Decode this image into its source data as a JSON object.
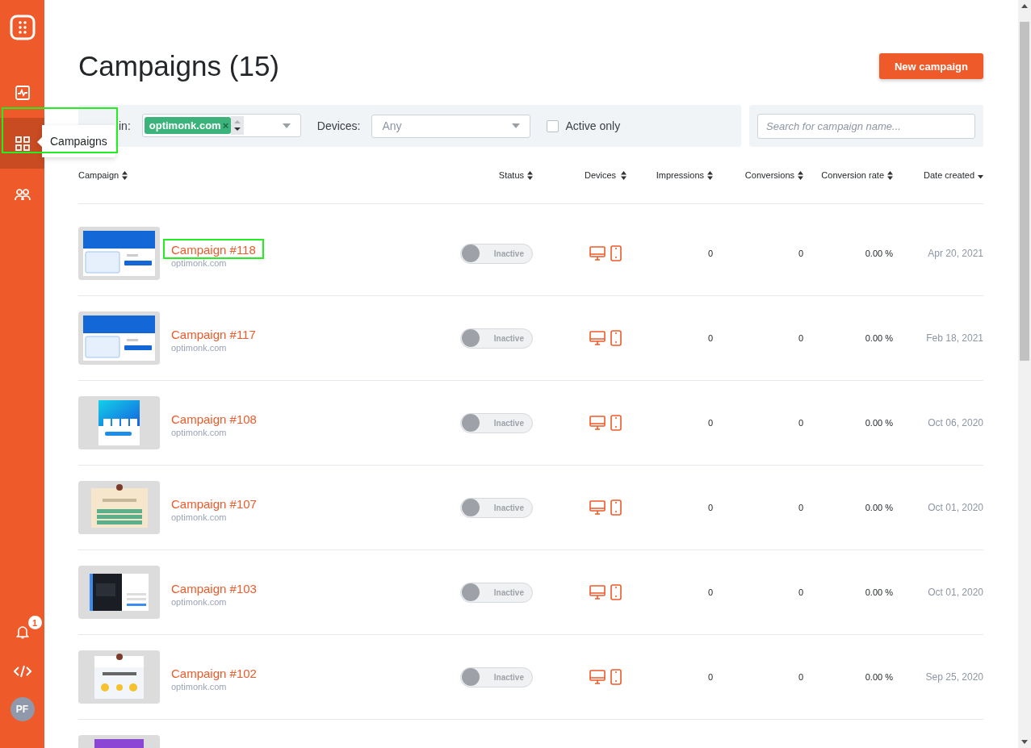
{
  "sidebar": {
    "nav": [
      {
        "selected": false
      },
      {
        "selected": true,
        "highlighted": true,
        "tooltip": "Campaigns"
      },
      {
        "selected": false
      }
    ],
    "notifications": {
      "badge": "1"
    },
    "avatar": {
      "initials": "PF"
    }
  },
  "header": {
    "title": "Campaigns (15)",
    "new_button": "New campaign"
  },
  "filters": {
    "domain_label": "in:",
    "domain_chip": "optimonk.com",
    "domain_chip_remove": "×",
    "devices_label": "Devices:",
    "devices_placeholder": "Any",
    "active_only": {
      "label": "Active only",
      "checked": false
    },
    "search": {
      "placeholder": "Search for campaign name..."
    }
  },
  "table": {
    "columns": [
      {
        "label": "Campaign",
        "sorted": false
      },
      {
        "label": "Status",
        "sorted": false
      },
      {
        "label": "Devices",
        "sorted": false
      },
      {
        "label": "Impressions",
        "sorted": false
      },
      {
        "label": "Conversions",
        "sorted": false
      },
      {
        "label": "Conversion rate",
        "sorted": false
      },
      {
        "label": "Date created",
        "sorted": true
      }
    ],
    "rows": [
      {
        "thumbnail": {
          "kind": "picture"
        },
        "name": "Campaign #118",
        "highlighted": true,
        "domain": "optimonk.com",
        "active": false,
        "status": "Inactive",
        "impressions": "0",
        "conversions": "0",
        "rate": "0.00 %",
        "date": "Apr 20, 2021"
      },
      {
        "thumbnail": {
          "kind": "picture"
        },
        "name": "Campaign #117",
        "highlighted": false,
        "domain": "optimonk.com",
        "active": false,
        "status": "Inactive",
        "impressions": "0",
        "conversions": "0",
        "rate": "0.00 %",
        "date": "Feb 18, 2021"
      },
      {
        "thumbnail": {
          "kind": "picture"
        },
        "name": "Campaign #108",
        "highlighted": false,
        "domain": "optimonk.com",
        "active": false,
        "status": "Inactive",
        "impressions": "0",
        "conversions": "0",
        "rate": "0.00 %",
        "date": "Oct 06, 2020"
      },
      {
        "thumbnail": {
          "kind": "picture"
        },
        "name": "Campaign #107",
        "highlighted": false,
        "domain": "optimonk.com",
        "active": false,
        "status": "Inactive",
        "impressions": "0",
        "conversions": "0",
        "rate": "0.00 %",
        "date": "Oct 01, 2020"
      },
      {
        "thumbnail": {
          "kind": "picture"
        },
        "name": "Campaign #103",
        "highlighted": false,
        "domain": "optimonk.com",
        "active": false,
        "status": "Inactive",
        "impressions": "0",
        "conversions": "0",
        "rate": "0.00 %",
        "date": "Oct 01, 2020"
      },
      {
        "thumbnail": {
          "kind": "picture"
        },
        "name": "Campaign #102",
        "highlighted": false,
        "domain": "optimonk.com",
        "active": false,
        "status": "Inactive",
        "impressions": "0",
        "conversions": "0",
        "rate": "0.00 %",
        "date": "Sep 25, 2020"
      },
      {
        "thumbnail": {
          "kind": "picture"
        }
      }
    ]
  }
}
